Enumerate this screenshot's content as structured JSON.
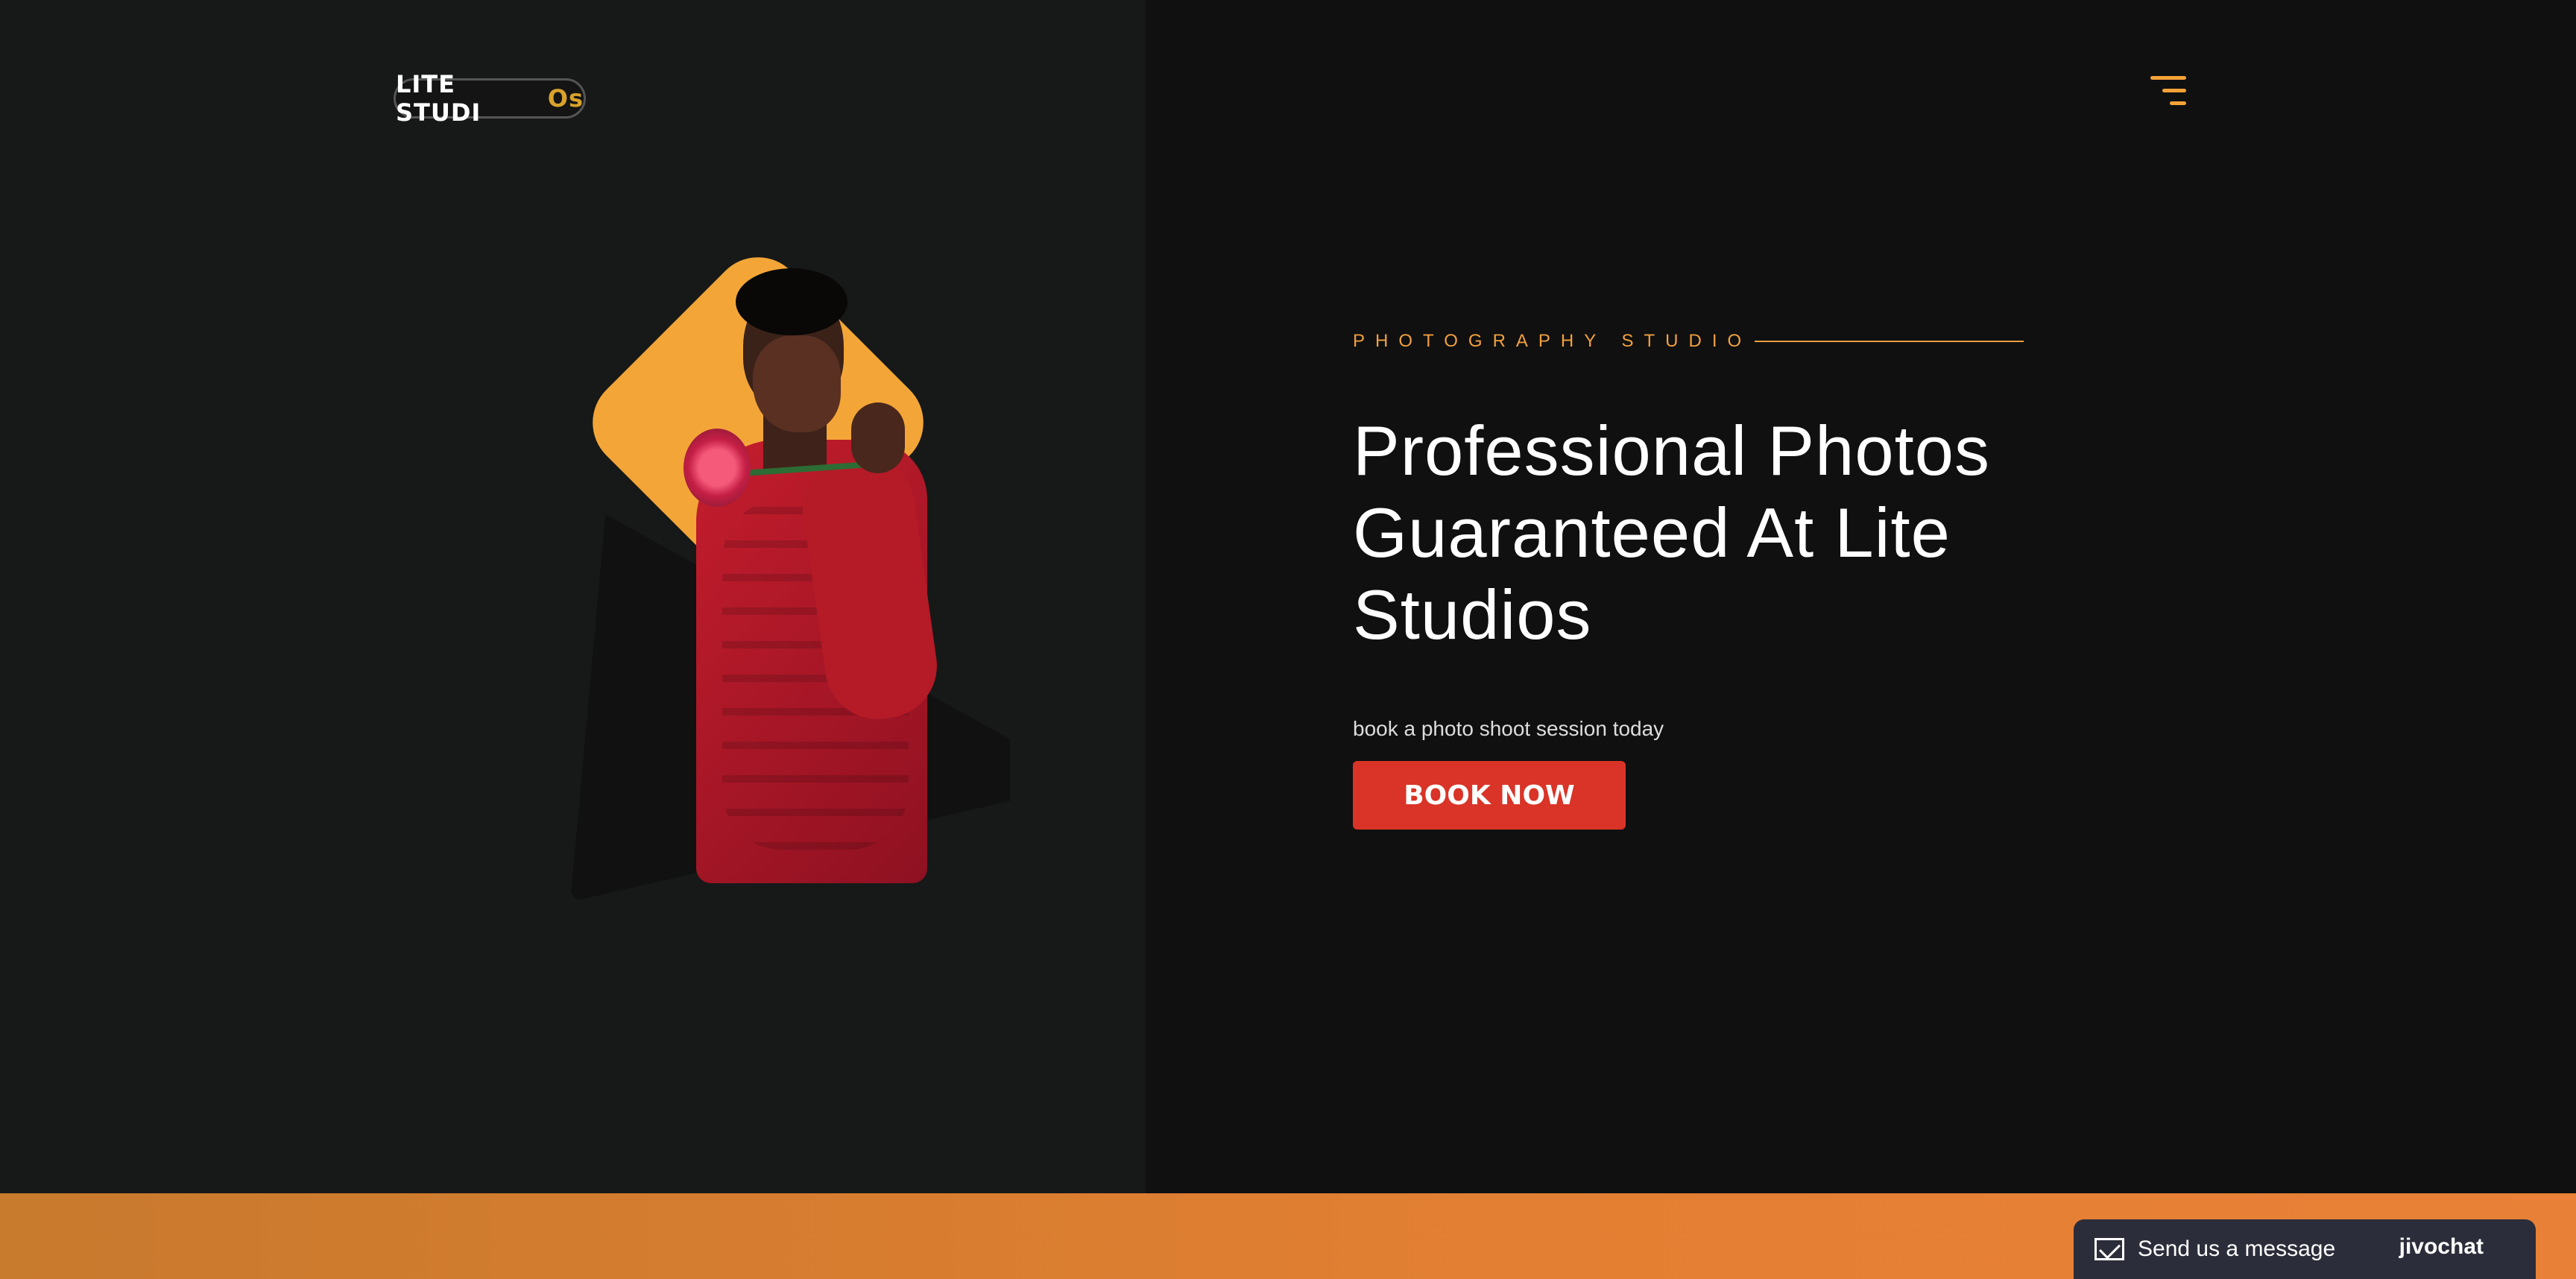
{
  "header": {
    "logo_text": "LITE STUDIOs",
    "logo_main": "LITE STUDI",
    "logo_accent": "Os",
    "menu_icon": "hamburger-menu-icon"
  },
  "hero": {
    "eyebrow": "PHOTOGRAPHY STUDIO",
    "title": "Professional Photos Guaranteed At Lite Studios",
    "subtitle": "book a photo shoot session today",
    "button_label": "BOOK NOW"
  },
  "chat": {
    "icon": "mail-icon",
    "message": "Send us a message",
    "brand": "jivochat"
  },
  "colors": {
    "accent_orange": "#f3a637",
    "cta_red": "#d93427",
    "background": "#101111"
  }
}
